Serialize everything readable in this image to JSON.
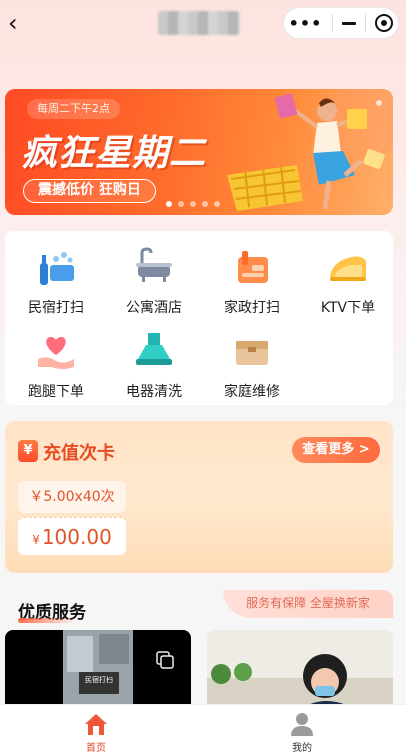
{
  "nav": {
    "back_icon": "chevron-left-icon",
    "more_icon": "•••"
  },
  "banner": {
    "tag": "每周二下午2点",
    "title": "疯狂星期二",
    "pill": "震撼低价 狂购日",
    "indicator_count": 5,
    "active_index": 0
  },
  "services": [
    {
      "label": "民宿打扫",
      "icon": "cleaning-spray-icon"
    },
    {
      "label": "公寓酒店",
      "icon": "bathtub-icon"
    },
    {
      "label": "家政打扫",
      "icon": "cleaning-tools-icon"
    },
    {
      "label": "KTV下单",
      "icon": "iron-icon"
    },
    {
      "label": "跑腿下单",
      "icon": "heart-hand-icon"
    },
    {
      "label": "电器清洗",
      "icon": "range-hood-icon"
    },
    {
      "label": "家庭维修",
      "icon": "toolbox-icon"
    }
  ],
  "recharge": {
    "title": "充值次卡",
    "more": "查看更多 >",
    "package": "￥5.00x40次",
    "price_symbol": "¥",
    "price": "100.00"
  },
  "quality": {
    "title": "优质服务",
    "slogan": "服务有保障 全屋换新家",
    "card1_caption": "民宿打扫"
  },
  "tabbar": {
    "home": "首页",
    "mine": "我的"
  },
  "colors": {
    "accent": "#e8452a",
    "banner_start": "#ff4a24",
    "banner_end": "#ffb06a"
  }
}
